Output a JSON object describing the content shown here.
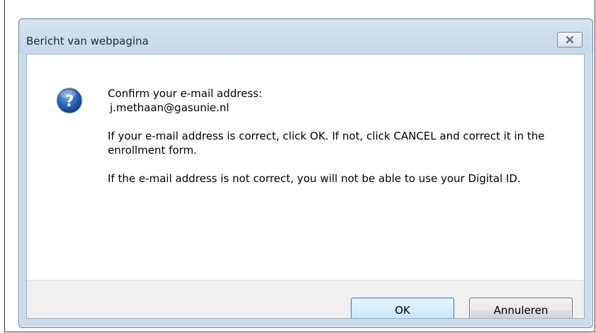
{
  "window": {
    "title": "Bericht van webpagina"
  },
  "message": {
    "line1": "Confirm your e-mail address:",
    "email": "j.methaan@gasunie.nl",
    "paragraph2": "If your e-mail address is correct, click OK. If not, click CANCEL and correct it in the enrollment form.",
    "paragraph3": "If the e-mail address is not correct, you will not be able to use your Digital ID."
  },
  "buttons": {
    "ok_label": "OK",
    "cancel_label": "Annuleren"
  },
  "icons": {
    "message_icon": "question-icon",
    "close_icon": "close-icon"
  },
  "colors": {
    "titlebar": "#cddbea",
    "ok_border": "#3c7fb1",
    "question_icon": "#1f5aa8"
  }
}
